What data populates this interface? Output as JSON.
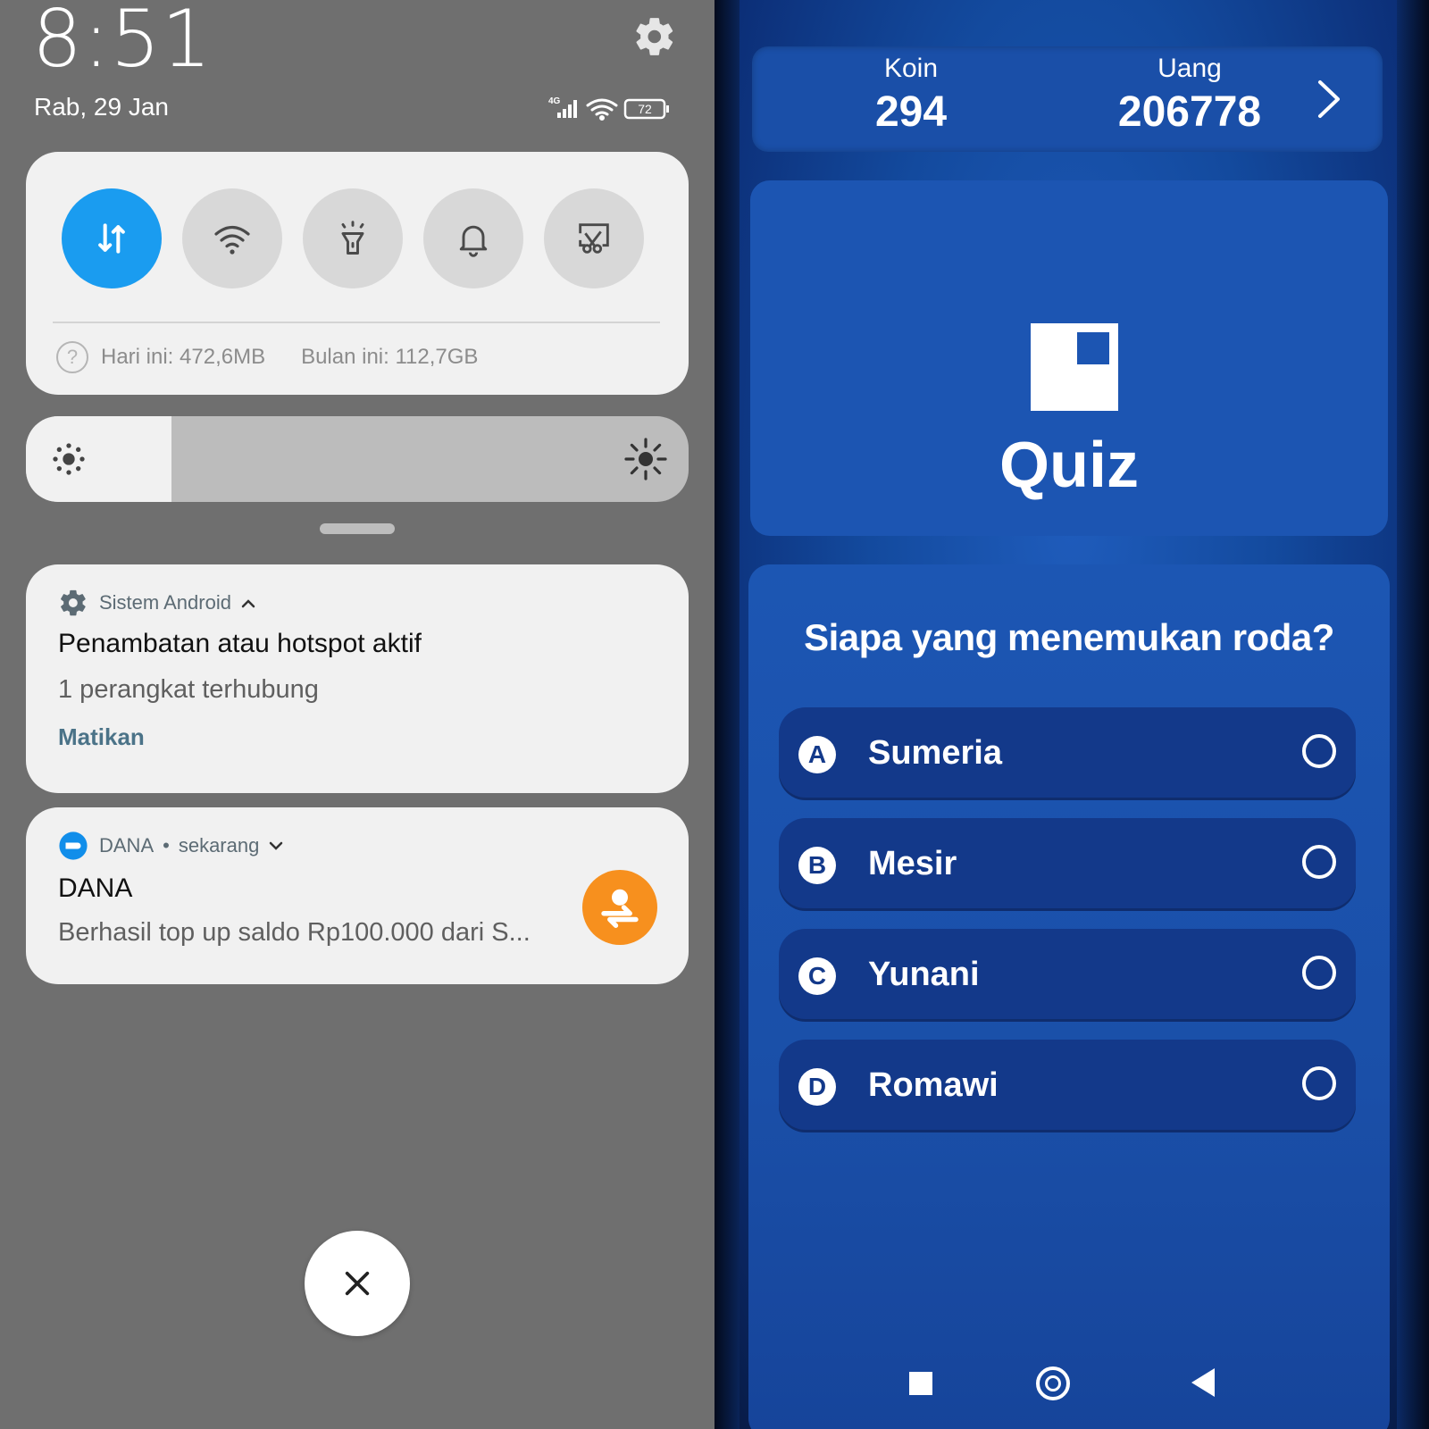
{
  "status": {
    "time": "8:51",
    "date": "Rab, 29 Jan",
    "network": "4G",
    "battery": "72"
  },
  "quick_settings": {
    "toggles": [
      {
        "name": "mobile-data",
        "icon": "mobile-data-arrows-icon",
        "active": true
      },
      {
        "name": "wifi",
        "icon": "wifi-icon",
        "active": false
      },
      {
        "name": "flashlight",
        "icon": "flashlight-icon",
        "active": false
      },
      {
        "name": "sound",
        "icon": "bell-icon",
        "active": false
      },
      {
        "name": "screenshot",
        "icon": "screenshot-scissors-icon",
        "active": false
      }
    ],
    "usage_today": "Hari ini: 472,6MB",
    "usage_month": "Bulan ini: 112,7GB"
  },
  "brightness": {
    "level": 0.22
  },
  "notifications": [
    {
      "app": "Sistem Android",
      "title": "Penambatan atau hotspot aktif",
      "text": "1 perangkat terhubung",
      "action": "Matikan"
    },
    {
      "app": "DANA",
      "time": "sekarang",
      "title": "DANA",
      "text": "Berhasil top up saldo Rp100.000 dari S..."
    }
  ],
  "quiz": {
    "koin_label": "Koin",
    "koin_value": "294",
    "uang_label": "Uang",
    "uang_value": "206778",
    "title": "Quiz",
    "question": "Siapa yang menemukan roda?",
    "options": [
      {
        "letter": "A",
        "text": "Sumeria"
      },
      {
        "letter": "B",
        "text": "Mesir"
      },
      {
        "letter": "C",
        "text": "Yunani"
      },
      {
        "letter": "D",
        "text": "Romawi"
      }
    ]
  },
  "colors": {
    "accent": "#1a9cf0",
    "shade_bg": "#6f6f6f",
    "dana_orange": "#f7901e",
    "quiz_blue": "#1a4fa8"
  }
}
